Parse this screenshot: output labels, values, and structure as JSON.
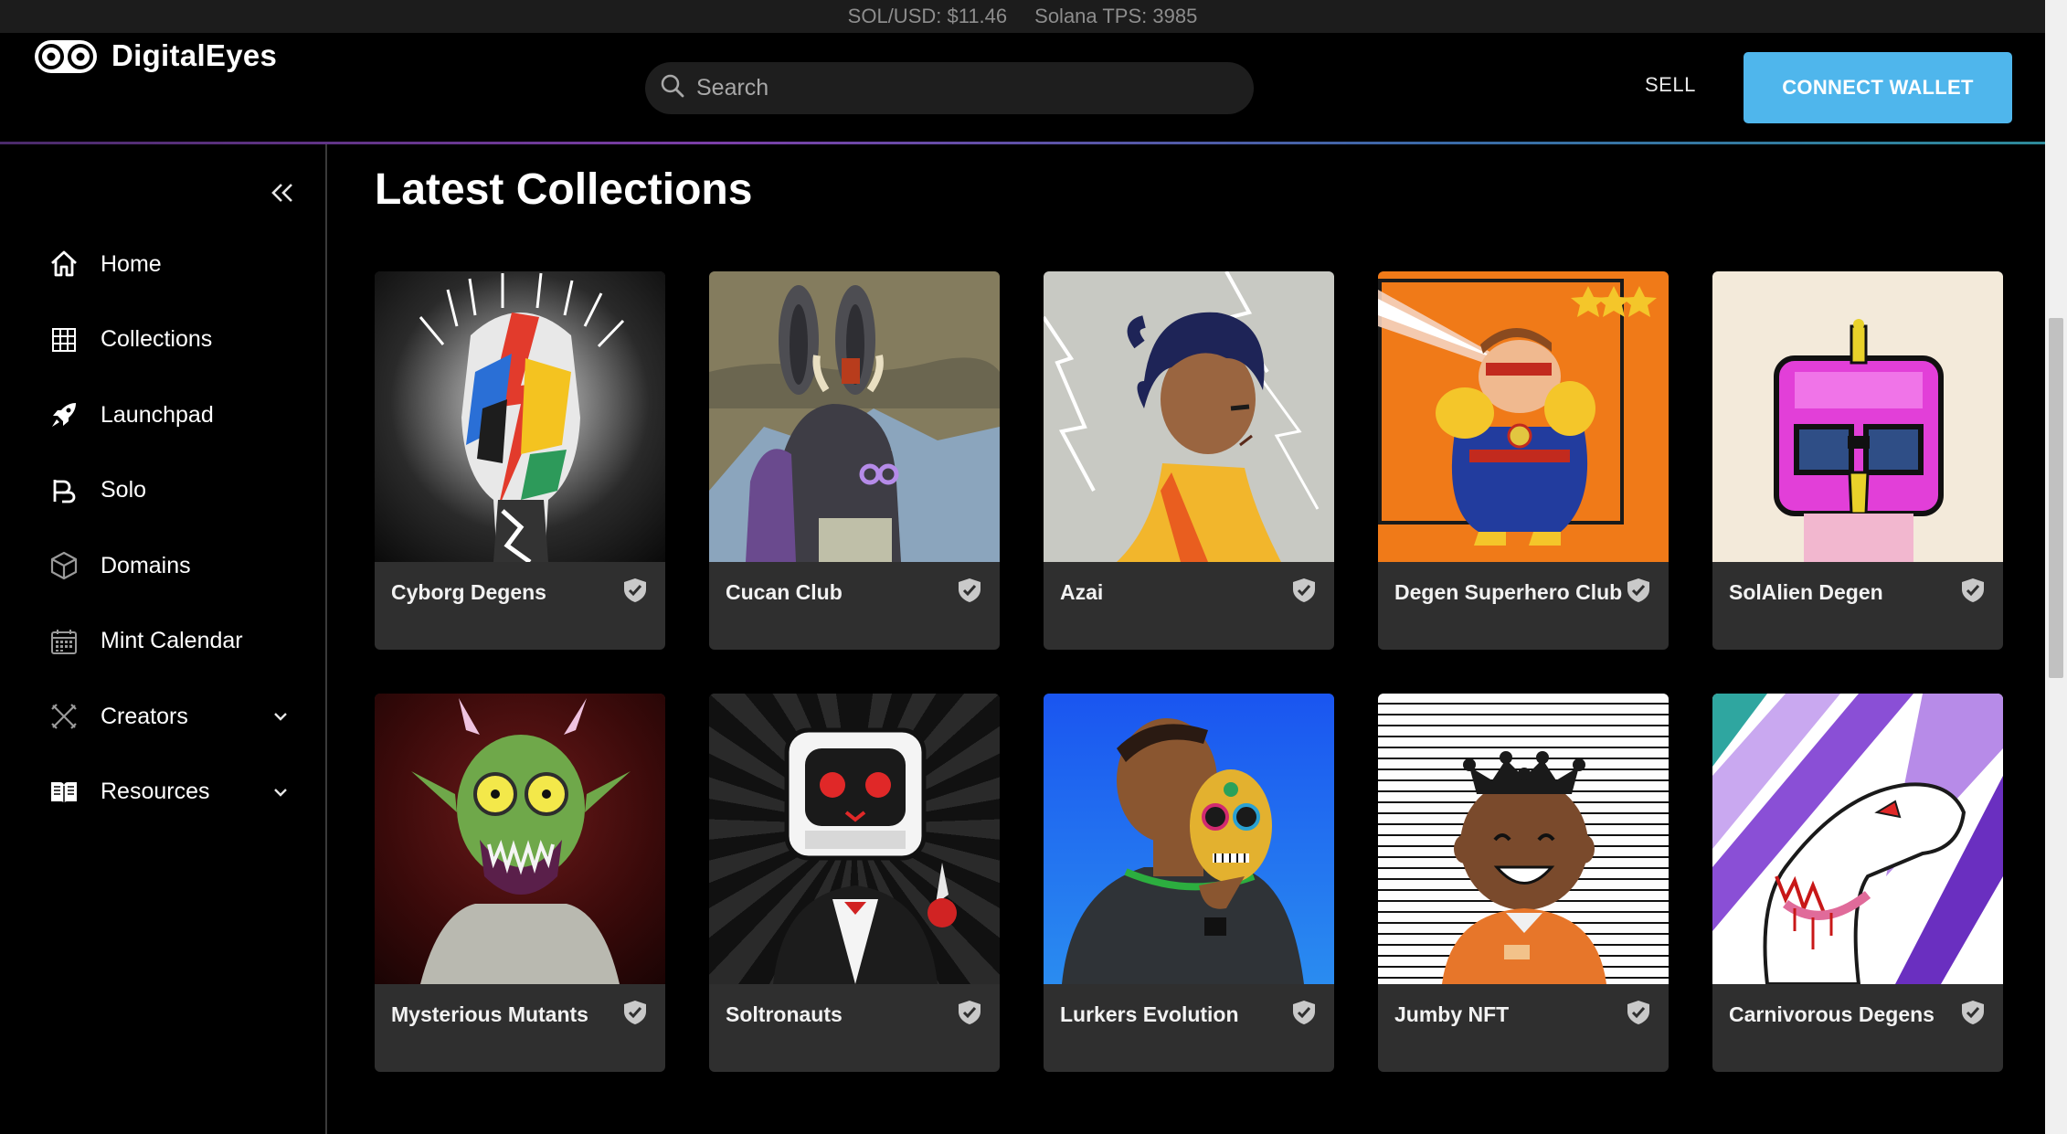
{
  "ticker": {
    "price": "SOL/USD: $11.46",
    "tps": "Solana TPS: 3985"
  },
  "header": {
    "logo_text": "DigitalEyes",
    "search_placeholder": "Search",
    "sell_label": "SELL",
    "connect_label": "CONNECT WALLET"
  },
  "sidebar": {
    "items": [
      {
        "label": "Home",
        "icon": "home-icon"
      },
      {
        "label": "Collections",
        "icon": "grid-icon"
      },
      {
        "label": "Launchpad",
        "icon": "rocket-icon"
      },
      {
        "label": "Solo",
        "icon": "solo-icon"
      },
      {
        "label": "Domains",
        "icon": "cube-icon"
      },
      {
        "label": "Mint Calendar",
        "icon": "calendar-icon"
      },
      {
        "label": "Creators",
        "icon": "creators-icon"
      },
      {
        "label": "Resources",
        "icon": "book-icon"
      }
    ]
  },
  "main": {
    "title": "Latest Collections",
    "collections": [
      {
        "name": "Cyborg Degens"
      },
      {
        "name": "Cucan Club"
      },
      {
        "name": "Azai"
      },
      {
        "name": "Degen Superhero Club"
      },
      {
        "name": "SolAlien Degen"
      },
      {
        "name": "Mysterious Mutants"
      },
      {
        "name": "Soltronauts"
      },
      {
        "name": "Lurkers Evolution"
      },
      {
        "name": "Jumby NFT"
      },
      {
        "name": "Carnivorous Degens"
      }
    ]
  },
  "colors": {
    "accent": "#4fb6ec",
    "card_bg": "#2f2f2f",
    "badge": "#c9c9c9"
  }
}
